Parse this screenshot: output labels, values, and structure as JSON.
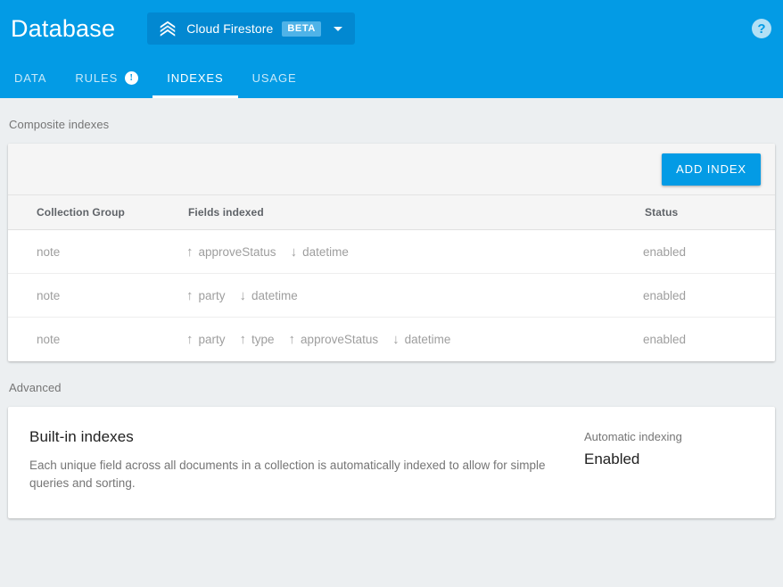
{
  "header": {
    "app_title": "Database",
    "db_selector": {
      "logo_icon": "firestore-logo-icon",
      "name": "Cloud Firestore",
      "badge": "BETA",
      "caret_icon": "chevron-down-icon"
    },
    "help_icon": "help-circle-icon",
    "background_color": "#039be5"
  },
  "tabs": [
    {
      "label": "DATA",
      "active": false,
      "badge": null
    },
    {
      "label": "RULES",
      "active": false,
      "badge": "!"
    },
    {
      "label": "INDEXES",
      "active": true,
      "badge": null
    },
    {
      "label": "USAGE",
      "active": false,
      "badge": null
    }
  ],
  "composite": {
    "section_label": "Composite indexes",
    "add_index_label": "ADD INDEX",
    "columns": [
      "Collection Group",
      "Fields indexed",
      "Status"
    ],
    "rows": [
      {
        "collection_group": "note",
        "fields": [
          {
            "dir": "↑",
            "name": "approveStatus"
          },
          {
            "dir": "↓",
            "name": "datetime"
          }
        ],
        "status": "enabled"
      },
      {
        "collection_group": "note",
        "fields": [
          {
            "dir": "↑",
            "name": "party"
          },
          {
            "dir": "↓",
            "name": "datetime"
          }
        ],
        "status": "enabled"
      },
      {
        "collection_group": "note",
        "fields": [
          {
            "dir": "↑",
            "name": "party"
          },
          {
            "dir": "↑",
            "name": "type"
          },
          {
            "dir": "↑",
            "name": "approveStatus"
          },
          {
            "dir": "↓",
            "name": "datetime"
          }
        ],
        "status": "enabled"
      }
    ]
  },
  "advanced": {
    "section_label": "Advanced",
    "builtin_title": "Built-in indexes",
    "builtin_description": "Each unique field across all documents in a collection is automatically indexed to allow for simple queries and sorting.",
    "automatic_indexing_label": "Automatic indexing",
    "automatic_indexing_value": "Enabled"
  },
  "colors": {
    "accent": "#039be5",
    "selector": "#0288d1",
    "badge": "#4fb3e8",
    "page_bg": "#eceff1",
    "card_bg": "#ffffff"
  }
}
